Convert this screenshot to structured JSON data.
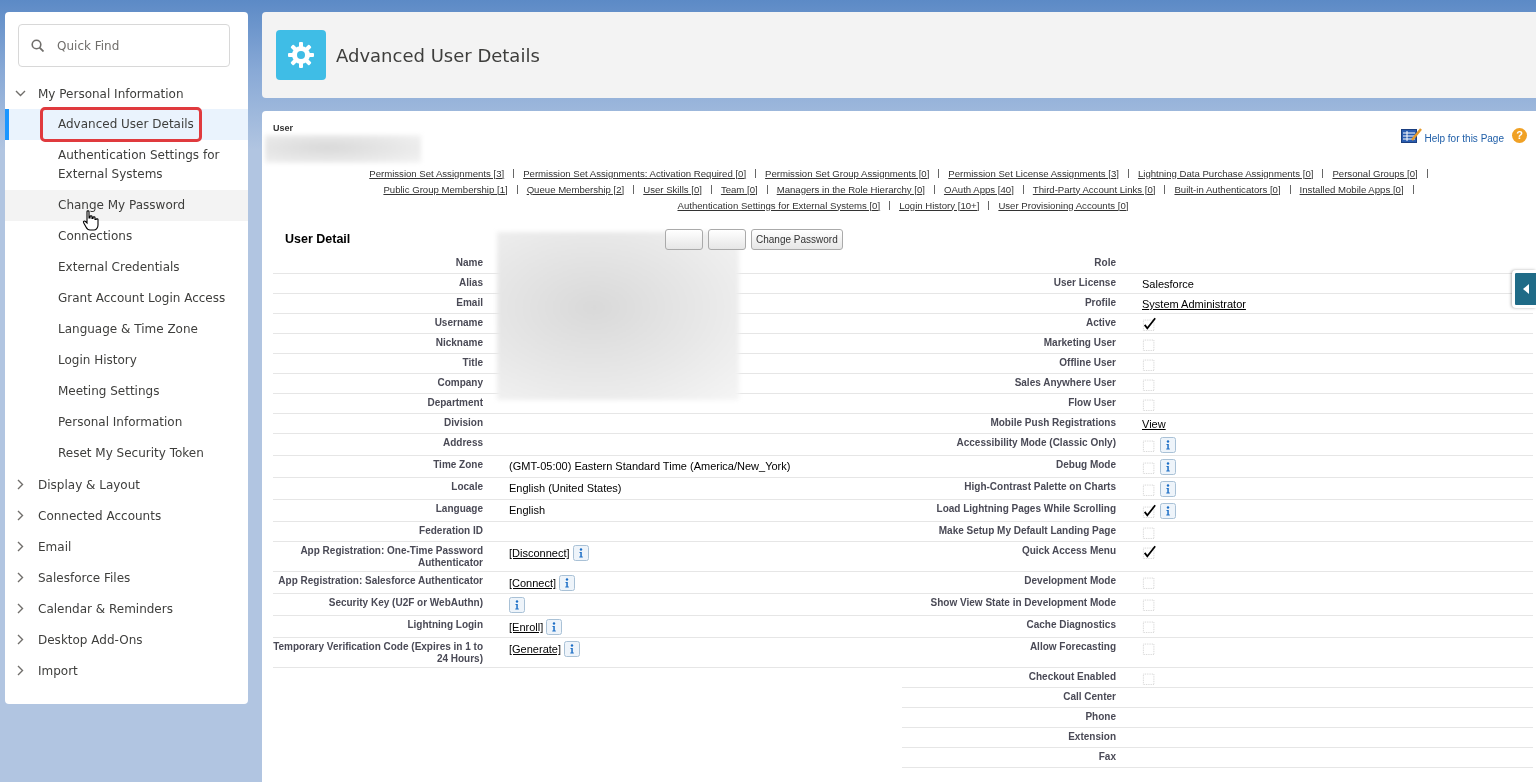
{
  "sidebar": {
    "search": {
      "placeholder": "Quick Find"
    },
    "items": [
      {
        "label": "My Personal Information",
        "expanded": true,
        "children": [
          {
            "label": "Advanced User Details",
            "selected": true,
            "hovered": false,
            "annotated": true
          },
          {
            "label": "Authentication Settings for External Systems",
            "selected": false,
            "hovered": false,
            "annotated": false
          },
          {
            "label": "Change My Password",
            "selected": false,
            "hovered": true,
            "annotated": false
          },
          {
            "label": "Connections",
            "selected": false,
            "hovered": false,
            "annotated": false
          },
          {
            "label": "External Credentials",
            "selected": false,
            "hovered": false,
            "annotated": false
          },
          {
            "label": "Grant Account Login Access",
            "selected": false,
            "hovered": false,
            "annotated": false
          },
          {
            "label": "Language & Time Zone",
            "selected": false,
            "hovered": false,
            "annotated": false
          },
          {
            "label": "Login History",
            "selected": false,
            "hovered": false,
            "annotated": false
          },
          {
            "label": "Meeting Settings",
            "selected": false,
            "hovered": false,
            "annotated": false
          },
          {
            "label": "Personal Information",
            "selected": false,
            "hovered": false,
            "annotated": false
          },
          {
            "label": "Reset My Security Token",
            "selected": false,
            "hovered": false,
            "annotated": false
          }
        ]
      },
      {
        "label": "Display & Layout",
        "expanded": false
      },
      {
        "label": "Connected Accounts",
        "expanded": false
      },
      {
        "label": "Email",
        "expanded": false
      },
      {
        "label": "Salesforce Files",
        "expanded": false
      },
      {
        "label": "Calendar & Reminders",
        "expanded": false
      },
      {
        "label": "Desktop Add-Ons",
        "expanded": false
      },
      {
        "label": "Import",
        "expanded": false
      }
    ]
  },
  "header": {
    "title": "Advanced User Details"
  },
  "record": {
    "type_label": "User",
    "help": {
      "label": "Help for this Page",
      "badge": "?"
    },
    "related_links": [
      [
        "Permission Set Assignments [3]",
        "Permission Set Assignments: Activation Required [0]",
        "Permission Set Group Assignments [0]",
        "Permission Set License Assignments [3]",
        "Lightning Data Purchase Assignments [0]",
        "Personal Groups [0]"
      ],
      [
        "Public Group Membership [1]",
        "Queue Membership [2]",
        "User Skills [0]",
        "Team [0]",
        "Managers in the Role Hierarchy [0]",
        "OAuth Apps [40]",
        "Third-Party Account Links [0]",
        "Built-in Authenticators [0]",
        "Installed Mobile Apps [0]"
      ],
      [
        "Authentication Settings for External Systems [0]",
        "Login History [10+]",
        "User Provisioning Accounts [0]"
      ]
    ]
  },
  "detail": {
    "title": "User Detail",
    "buttons": [
      {
        "obscured": true
      },
      {
        "obscured": true
      },
      {
        "label": "Change Password",
        "obscured": false
      }
    ],
    "rows": [
      {
        "left": {
          "label": "Name",
          "kind": "none"
        },
        "right": {
          "label": "Role",
          "kind": "none"
        }
      },
      {
        "left": {
          "label": "Alias",
          "kind": "none"
        },
        "right": {
          "label": "User License",
          "kind": "text",
          "value": "Salesforce"
        }
      },
      {
        "left": {
          "label": "Email",
          "kind": "none"
        },
        "right": {
          "label": "Profile",
          "kind": "link",
          "value": "System Administrator"
        }
      },
      {
        "left": {
          "label": "Username",
          "kind": "none"
        },
        "right": {
          "label": "Active",
          "kind": "checkbox",
          "checked": true
        }
      },
      {
        "left": {
          "label": "Nickname",
          "kind": "none"
        },
        "right": {
          "label": "Marketing User",
          "kind": "checkbox",
          "checked": false
        }
      },
      {
        "left": {
          "label": "Title",
          "kind": "none"
        },
        "right": {
          "label": "Offline User",
          "kind": "checkbox",
          "checked": false
        }
      },
      {
        "left": {
          "label": "Company",
          "kind": "none"
        },
        "right": {
          "label": "Sales Anywhere User",
          "kind": "checkbox",
          "checked": false
        }
      },
      {
        "left": {
          "label": "Department",
          "kind": "none"
        },
        "right": {
          "label": "Flow User",
          "kind": "checkbox",
          "checked": false
        }
      },
      {
        "left": {
          "label": "Division",
          "kind": "none"
        },
        "right": {
          "label": "Mobile Push Registrations",
          "kind": "link",
          "value": "View"
        }
      },
      {
        "left": {
          "label": "Address",
          "kind": "none"
        },
        "right": {
          "label": "Accessibility Mode (Classic Only)",
          "kind": "checkbox",
          "checked": false,
          "info": true
        }
      },
      {
        "left": {
          "label": "Time Zone",
          "kind": "text",
          "value": "(GMT-05:00) Eastern Standard Time (America/New_York)"
        },
        "right": {
          "label": "Debug Mode",
          "kind": "checkbox",
          "checked": false,
          "info": true
        }
      },
      {
        "left": {
          "label": "Locale",
          "kind": "text",
          "value": "English (United States)"
        },
        "right": {
          "label": "High-Contrast Palette on Charts",
          "kind": "checkbox",
          "checked": false,
          "info": true
        }
      },
      {
        "left": {
          "label": "Language",
          "kind": "text",
          "value": "English"
        },
        "right": {
          "label": "Load Lightning Pages While Scrolling",
          "kind": "checkbox",
          "checked": true,
          "info": true
        }
      },
      {
        "left": {
          "label": "Federation ID",
          "kind": "none"
        },
        "right": {
          "label": "Make Setup My Default Landing Page",
          "kind": "checkbox",
          "checked": false
        }
      },
      {
        "left": {
          "label": "App Registration: One-Time Password Authenticator",
          "kind": "link",
          "value": "[Disconnect]",
          "info": true
        },
        "right": {
          "label": "Quick Access Menu",
          "kind": "checkbox",
          "checked": true
        }
      },
      {
        "left": {
          "label": "App Registration: Salesforce Authenticator",
          "kind": "link",
          "value": "[Connect]",
          "info": true
        },
        "right": {
          "label": "Development Mode",
          "kind": "checkbox",
          "checked": false
        }
      },
      {
        "left": {
          "label": "Security Key (U2F or WebAuthn)",
          "kind": "none",
          "info": true
        },
        "right": {
          "label": "Show View State in Development Mode",
          "kind": "checkbox",
          "checked": false
        }
      },
      {
        "left": {
          "label": "Lightning Login",
          "kind": "link",
          "value": "[Enroll]",
          "info": true
        },
        "right": {
          "label": "Cache Diagnostics",
          "kind": "checkbox",
          "checked": false
        }
      },
      {
        "left": {
          "label": "Temporary Verification Code (Expires in 1 to 24 Hours)",
          "kind": "link",
          "value": "[Generate]",
          "info": true
        },
        "right": {
          "label": "Allow Forecasting",
          "kind": "checkbox",
          "checked": false
        }
      },
      {
        "right": {
          "label": "Checkout Enabled",
          "kind": "checkbox",
          "checked": false
        }
      },
      {
        "right": {
          "label": "Call Center",
          "kind": "none"
        }
      },
      {
        "right": {
          "label": "Phone",
          "kind": "none"
        }
      },
      {
        "right": {
          "label": "Extension",
          "kind": "none"
        }
      },
      {
        "right": {
          "label": "Fax",
          "kind": "none"
        }
      }
    ]
  }
}
